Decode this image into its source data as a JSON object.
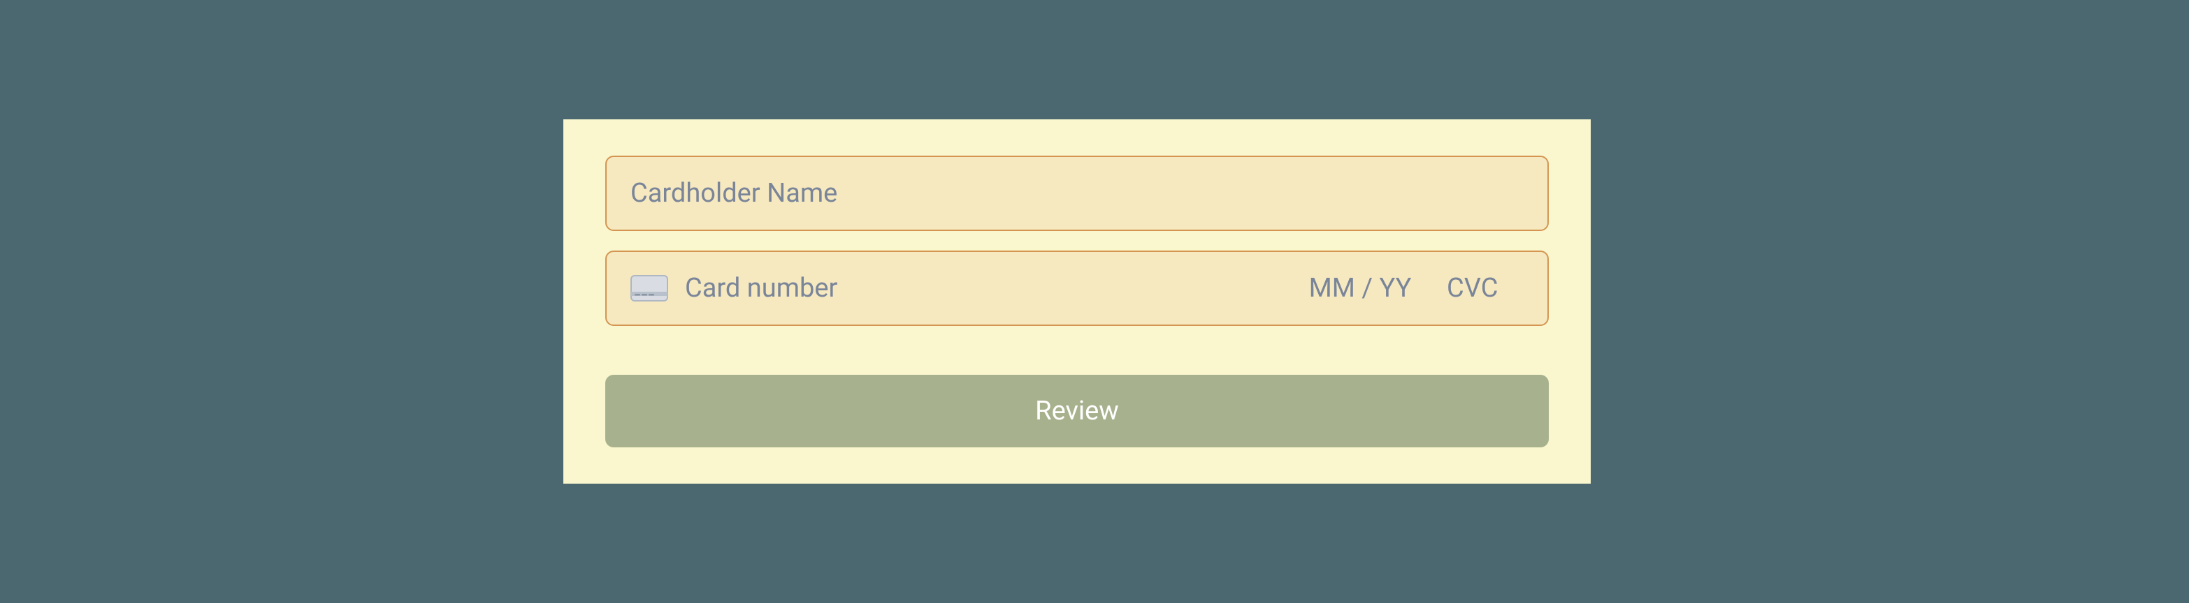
{
  "form": {
    "cardholder_name": {
      "placeholder": "Cardholder Name",
      "value": ""
    },
    "card_number": {
      "placeholder": "Card number",
      "value": ""
    },
    "expiry": {
      "placeholder": "MM / YY",
      "value": ""
    },
    "cvc": {
      "placeholder": "CVC",
      "value": ""
    },
    "submit_label": "Review"
  },
  "icons": {
    "card": "credit-card-icon"
  },
  "colors": {
    "page_bg": "#4b6870",
    "card_bg": "#faf7ce",
    "input_bg": "#f6e9bf",
    "input_border": "#d49552",
    "placeholder": "#7a8599",
    "button_bg": "#a7b18d",
    "button_text": "#ffffff"
  }
}
